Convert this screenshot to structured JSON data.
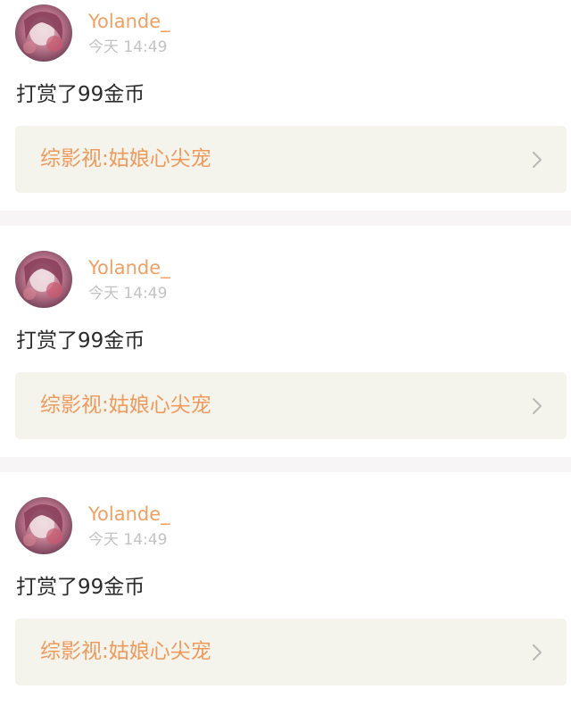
{
  "feed": {
    "items": [
      {
        "user": {
          "name": "Yolande_",
          "time": "今天 14:49"
        },
        "message": "打赏了99金币",
        "book": {
          "title": "综影视:姑娘心尖宠"
        }
      },
      {
        "user": {
          "name": "Yolande_",
          "time": "今天 14:49"
        },
        "message": "打赏了99金币",
        "book": {
          "title": "综影视:姑娘心尖宠"
        }
      },
      {
        "user": {
          "name": "Yolande_",
          "time": "今天 14:49"
        },
        "message": "打赏了99金币",
        "book": {
          "title": "综影视:姑娘心尖宠"
        }
      }
    ]
  },
  "icons": {
    "avatar": "avatar-image",
    "link_arrow": "chevron-right-icon"
  },
  "colors": {
    "username": "#f0a064",
    "book_title": "#ef9a5d",
    "link_background": "#f4f4ec",
    "page_background": "#f7f5f6",
    "timestamp": "#c3c3c3"
  }
}
